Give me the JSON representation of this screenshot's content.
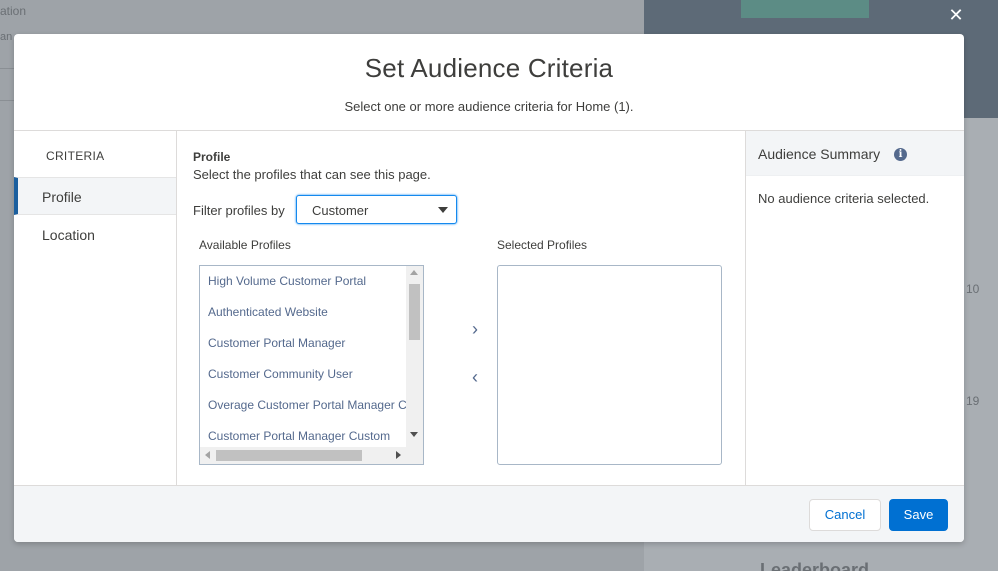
{
  "background": {
    "text_top": "ation",
    "text_second": "an",
    "num_a": "10",
    "num_b": "19",
    "leaderboard": "Leaderboard"
  },
  "close_glyph": "✕",
  "modal": {
    "title": "Set Audience Criteria",
    "subtitle": "Select one or more audience criteria for Home (1)."
  },
  "criteria": {
    "heading": "CRITERIA",
    "items": [
      "Profile",
      "Location"
    ],
    "active": "Profile"
  },
  "profile": {
    "section_title": "Profile",
    "description": "Select the profiles that can see this page.",
    "filter_label": "Filter profiles by",
    "filter_value": "Customer",
    "available_label": "Available Profiles",
    "selected_label": "Selected Profiles",
    "available_profiles": [
      "High Volume Customer Portal",
      "Authenticated Website",
      "Customer Portal Manager",
      "Customer Community User",
      "Overage Customer Portal Manager Cu",
      "Customer Portal Manager Custom"
    ],
    "selected_profiles": [],
    "move_right_glyph": "›",
    "move_left_glyph": "‹"
  },
  "summary": {
    "title": "Audience Summary",
    "info_glyph": "i",
    "empty_text": "No audience criteria selected."
  },
  "footer": {
    "cancel_label": "Cancel",
    "save_label": "Save"
  },
  "colors": {
    "brand": "#0070d2",
    "nav_accent": "#1b5f9e",
    "link_text": "#54698d"
  }
}
